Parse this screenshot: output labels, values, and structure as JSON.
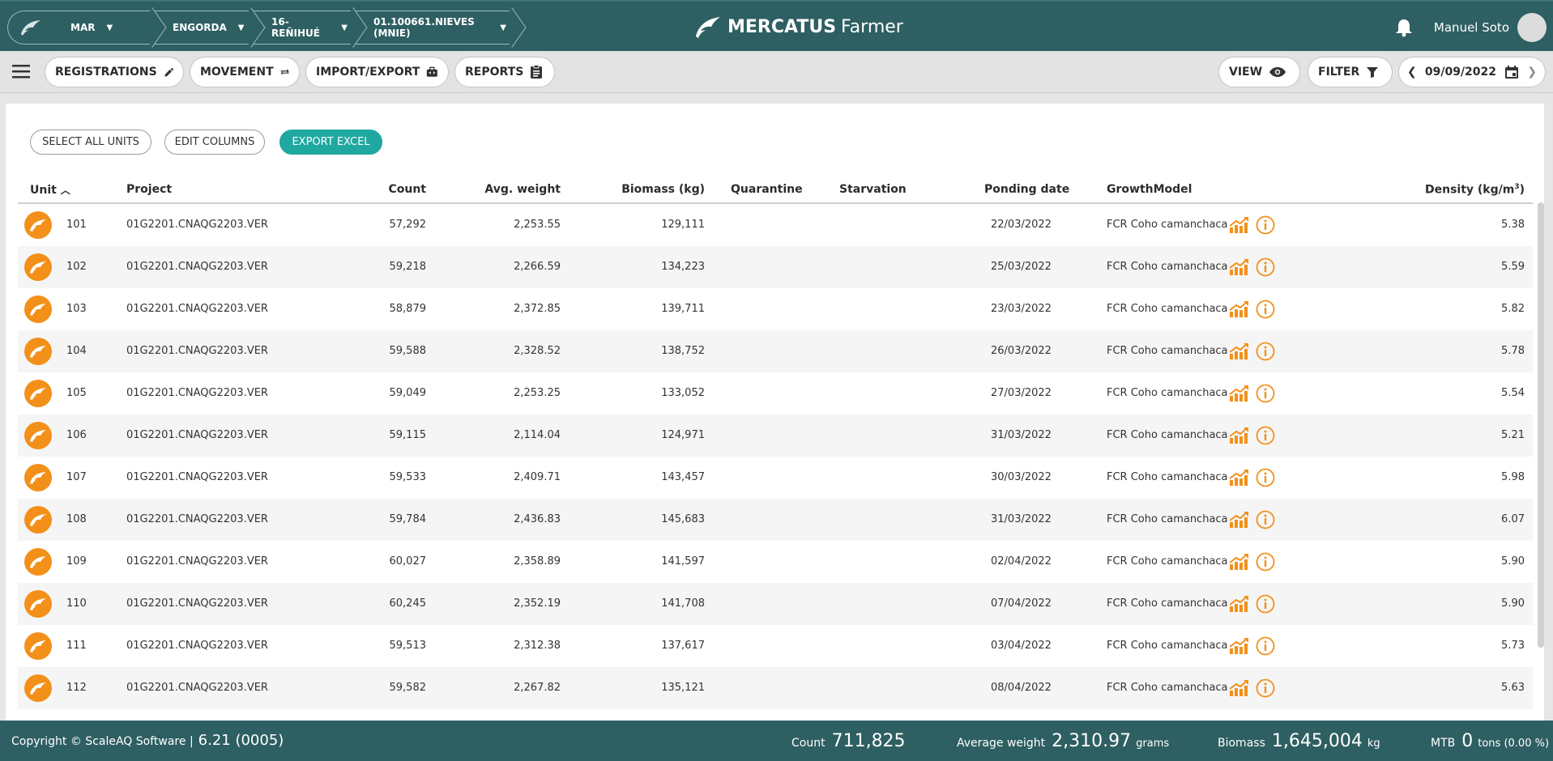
{
  "breadcrumb": [
    "MAR",
    "ENGORDA",
    "16-REÑIHUÉ",
    "01.100661.NIEVES (MNIE)"
  ],
  "brand": {
    "bold": "MERCATUS",
    "light": "Farmer"
  },
  "user": {
    "name": "Manuel Soto"
  },
  "toolbar": {
    "registrations": "REGISTRATIONS",
    "movement": "MOVEMENT",
    "import_export": "IMPORT/EXPORT",
    "reports": "REPORTS",
    "view": "VIEW",
    "filter": "FILTER",
    "date": "09/09/2022"
  },
  "actions": {
    "select_all": "SELECT ALL UNITS",
    "edit_columns": "EDIT COLUMNS",
    "export_excel": "EXPORT EXCEL"
  },
  "columns": {
    "unit": "Unit",
    "project": "Project",
    "count": "Count",
    "avg_weight": "Avg. weight",
    "biomass": "Biomass (kg)",
    "quarantine": "Quarantine",
    "starvation": "Starvation",
    "ponding_date": "Ponding date",
    "growth_model": "GrowthModel",
    "density": "Density (kg/m",
    "density_sup": "3",
    "density_close": ")"
  },
  "rows": [
    {
      "unit": "101",
      "project": "01G2201.CNAQG2203.VER",
      "count": "57,292",
      "avg_weight": "2,253.55",
      "biomass": "129,111",
      "ponding_date": "22/03/2022",
      "growth_model": "FCR Coho camanchaca",
      "density": "5.38"
    },
    {
      "unit": "102",
      "project": "01G2201.CNAQG2203.VER",
      "count": "59,218",
      "avg_weight": "2,266.59",
      "biomass": "134,223",
      "ponding_date": "25/03/2022",
      "growth_model": "FCR Coho camanchaca",
      "density": "5.59"
    },
    {
      "unit": "103",
      "project": "01G2201.CNAQG2203.VER",
      "count": "58,879",
      "avg_weight": "2,372.85",
      "biomass": "139,711",
      "ponding_date": "23/03/2022",
      "growth_model": "FCR Coho camanchaca",
      "density": "5.82"
    },
    {
      "unit": "104",
      "project": "01G2201.CNAQG2203.VER",
      "count": "59,588",
      "avg_weight": "2,328.52",
      "biomass": "138,752",
      "ponding_date": "26/03/2022",
      "growth_model": "FCR Coho camanchaca",
      "density": "5.78"
    },
    {
      "unit": "105",
      "project": "01G2201.CNAQG2203.VER",
      "count": "59,049",
      "avg_weight": "2,253.25",
      "biomass": "133,052",
      "ponding_date": "27/03/2022",
      "growth_model": "FCR Coho camanchaca",
      "density": "5.54"
    },
    {
      "unit": "106",
      "project": "01G2201.CNAQG2203.VER",
      "count": "59,115",
      "avg_weight": "2,114.04",
      "biomass": "124,971",
      "ponding_date": "31/03/2022",
      "growth_model": "FCR Coho camanchaca",
      "density": "5.21"
    },
    {
      "unit": "107",
      "project": "01G2201.CNAQG2203.VER",
      "count": "59,533",
      "avg_weight": "2,409.71",
      "biomass": "143,457",
      "ponding_date": "30/03/2022",
      "growth_model": "FCR Coho camanchaca",
      "density": "5.98"
    },
    {
      "unit": "108",
      "project": "01G2201.CNAQG2203.VER",
      "count": "59,784",
      "avg_weight": "2,436.83",
      "biomass": "145,683",
      "ponding_date": "31/03/2022",
      "growth_model": "FCR Coho camanchaca",
      "density": "6.07"
    },
    {
      "unit": "109",
      "project": "01G2201.CNAQG2203.VER",
      "count": "60,027",
      "avg_weight": "2,358.89",
      "biomass": "141,597",
      "ponding_date": "02/04/2022",
      "growth_model": "FCR Coho camanchaca",
      "density": "5.90"
    },
    {
      "unit": "110",
      "project": "01G2201.CNAQG2203.VER",
      "count": "60,245",
      "avg_weight": "2,352.19",
      "biomass": "141,708",
      "ponding_date": "07/04/2022",
      "growth_model": "FCR Coho camanchaca",
      "density": "5.90"
    },
    {
      "unit": "111",
      "project": "01G2201.CNAQG2203.VER",
      "count": "59,513",
      "avg_weight": "2,312.38",
      "biomass": "137,617",
      "ponding_date": "03/04/2022",
      "growth_model": "FCR Coho camanchaca",
      "density": "5.73"
    },
    {
      "unit": "112",
      "project": "01G2201.CNAQG2203.VER",
      "count": "59,582",
      "avg_weight": "2,267.82",
      "biomass": "135,121",
      "ponding_date": "08/04/2022",
      "growth_model": "FCR Coho camanchaca",
      "density": "5.63"
    }
  ],
  "footer": {
    "copyright": "Copyright © ScaleAQ Software |",
    "version": "6.21 (0005)",
    "count_label": "Count",
    "count_value": "711,825",
    "avg_label": "Average weight",
    "avg_value": "2,310.97",
    "avg_unit": "grams",
    "biomass_label": "Biomass",
    "biomass_value": "1,645,004",
    "biomass_unit": "kg",
    "mtb_label": "MTB",
    "mtb_value": "0",
    "mtb_unit": "tons (0.00 %)"
  },
  "colors": {
    "header": "#2e5f62",
    "accent": "#1fa89f",
    "unit_badge": "#f39019"
  }
}
